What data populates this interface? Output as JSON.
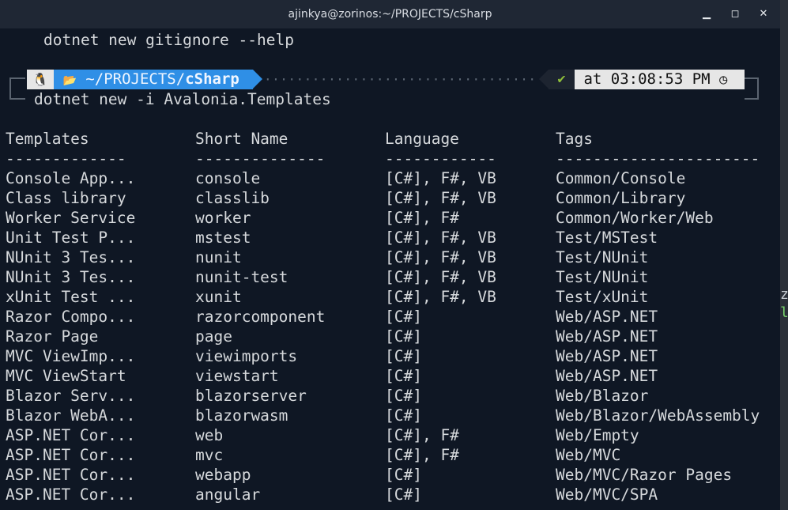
{
  "window": {
    "title": "ajinkya@zorinos:~/PROJECTS/cSharp",
    "minimize_glyph": "▁",
    "maximize_glyph": "◻",
    "close_glyph": "✕"
  },
  "terminal": {
    "previous_command": "dotnet new gitignore --help",
    "prompt": {
      "os_icon": "🐧",
      "folder_icon": "📂",
      "path_prefix": "~/PROJECTS/",
      "path_dir": "cSharp",
      "dots": "····································································",
      "status_check": "✔",
      "time_text": "at 03:08:53 PM",
      "clock_icon": "◷"
    },
    "command": "dotnet new -i Avalonia.Templates",
    "table": {
      "headers": [
        "Templates",
        "Short Name",
        "Language",
        "Tags"
      ],
      "separators": [
        "-------------",
        "--------------",
        "------------",
        "----------------------"
      ],
      "rows": [
        [
          "Console App...",
          "console",
          "[C#], F#, VB",
          "Common/Console"
        ],
        [
          "Class library",
          "classlib",
          "[C#], F#, VB",
          "Common/Library"
        ],
        [
          "Worker Service",
          "worker",
          "[C#], F#",
          "Common/Worker/Web"
        ],
        [
          "Unit Test P...",
          "mstest",
          "[C#], F#, VB",
          "Test/MSTest"
        ],
        [
          "NUnit 3 Tes...",
          "nunit",
          "[C#], F#, VB",
          "Test/NUnit"
        ],
        [
          "NUnit 3 Tes...",
          "nunit-test",
          "[C#], F#, VB",
          "Test/NUnit"
        ],
        [
          "xUnit Test ...",
          "xunit",
          "[C#], F#, VB",
          "Test/xUnit"
        ],
        [
          "Razor Compo...",
          "razorcomponent",
          "[C#]",
          "Web/ASP.NET"
        ],
        [
          "Razor Page",
          "page",
          "[C#]",
          "Web/ASP.NET"
        ],
        [
          "MVC ViewImp...",
          "viewimports",
          "[C#]",
          "Web/ASP.NET"
        ],
        [
          "MVC ViewStart",
          "viewstart",
          "[C#]",
          "Web/ASP.NET"
        ],
        [
          "Blazor Serv...",
          "blazorserver",
          "[C#]",
          "Web/Blazor"
        ],
        [
          "Blazor WebA...",
          "blazorwasm",
          "[C#]",
          "Web/Blazor/WebAssembly"
        ],
        [
          "ASP.NET Cor...",
          "web",
          "[C#], F#",
          "Web/Empty"
        ],
        [
          "ASP.NET Cor...",
          "mvc",
          "[C#], F#",
          "Web/MVC"
        ],
        [
          "ASP.NET Cor...",
          "webapp",
          "[C#]",
          "Web/MVC/Razor Pages"
        ],
        [
          "ASP.NET Cor...",
          "angular",
          "[C#]",
          "Web/MVC/SPA"
        ]
      ]
    }
  },
  "background_window": {
    "fragment_1": "z",
    "fragment_2": "l"
  },
  "colors": {
    "terminal_bg": "#0f1724",
    "text": "#d6d9dc",
    "path_segment": "#2f8fe6",
    "status_check": "#8fbf3a"
  }
}
